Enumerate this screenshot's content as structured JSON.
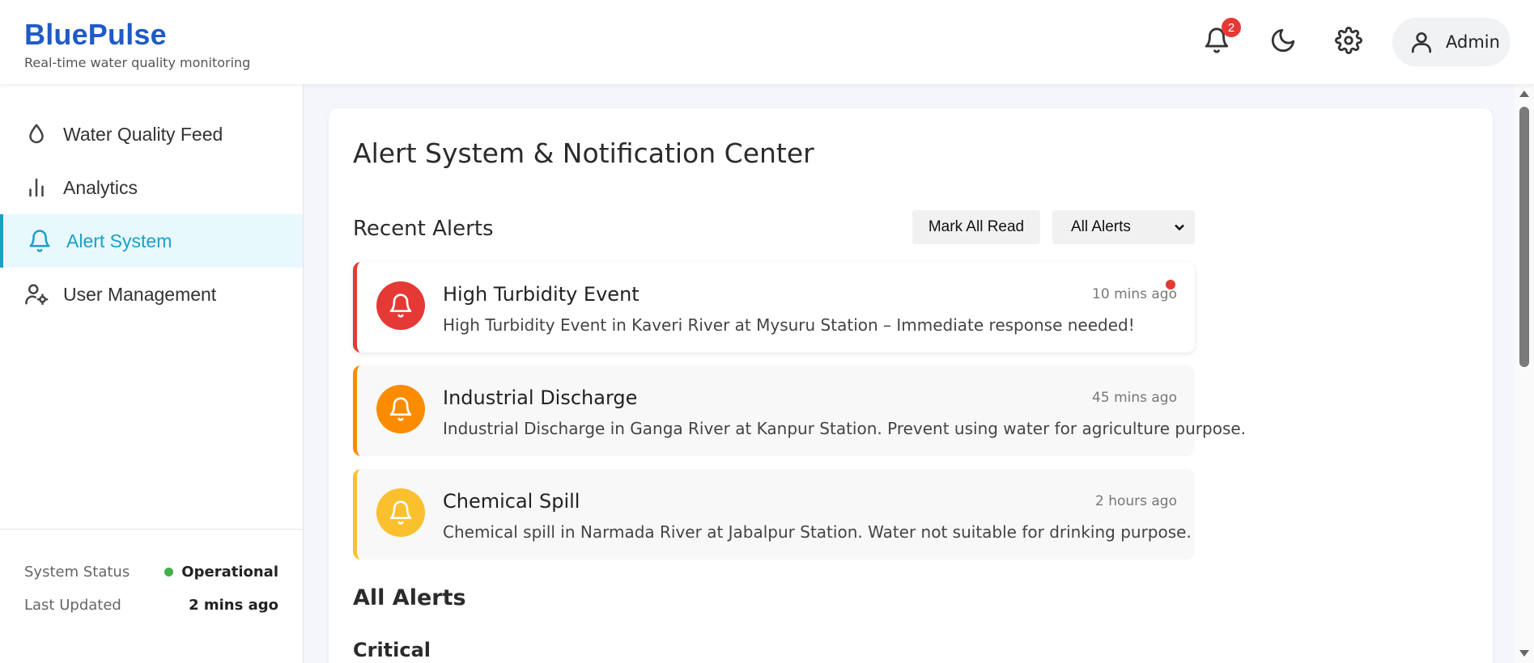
{
  "header": {
    "brand": "BluePulse",
    "tagline": "Real-time water quality monitoring",
    "notification_count": "2",
    "user_label": "Admin",
    "icons": [
      "bell-icon",
      "moon-icon",
      "gear-icon",
      "user-icon"
    ]
  },
  "sidebar": {
    "items": [
      {
        "label": "Water Quality Feed",
        "icon": "droplet-icon",
        "active": false
      },
      {
        "label": "Analytics",
        "icon": "bar-chart-icon",
        "active": false
      },
      {
        "label": "Alert System",
        "icon": "bell-icon",
        "active": true
      },
      {
        "label": "User Management",
        "icon": "user-gear-icon",
        "active": false
      }
    ],
    "status": {
      "system_status_label": "System Status",
      "system_status_value": "Operational",
      "last_updated_label": "Last Updated",
      "last_updated_value": "2 mins ago"
    }
  },
  "main": {
    "page_title": "Alert System & Notification Center",
    "recent_title": "Recent Alerts",
    "mark_all_read": "Mark All Read",
    "filter_selected": "All Alerts",
    "alerts": [
      {
        "title": "High Turbidity Event",
        "message": "High Turbidity Event in Kaveri River at Mysuru Station – Immediate response needed!",
        "time": "10 mins ago",
        "color": "#e53935",
        "unread": true
      },
      {
        "title": "Industrial Discharge",
        "message": "Industrial Discharge in Ganga River at Kanpur Station. Prevent using water for agriculture purpose.",
        "time": "45 mins ago",
        "color": "#fb8c00",
        "unread": false
      },
      {
        "title": "Chemical Spill",
        "message": "Chemical spill in Narmada River at Jabalpur Station. Water not suitable for drinking purpose.",
        "time": "2 hours ago",
        "color": "#fbc02d",
        "unread": false
      }
    ],
    "all_alerts_title": "All Alerts",
    "critical_title": "Critical"
  },
  "colors": {
    "brand": "#1f5bc6",
    "active_nav": "#1a9fc9",
    "status_green": "#43b14a",
    "badge_red": "#e53935"
  }
}
